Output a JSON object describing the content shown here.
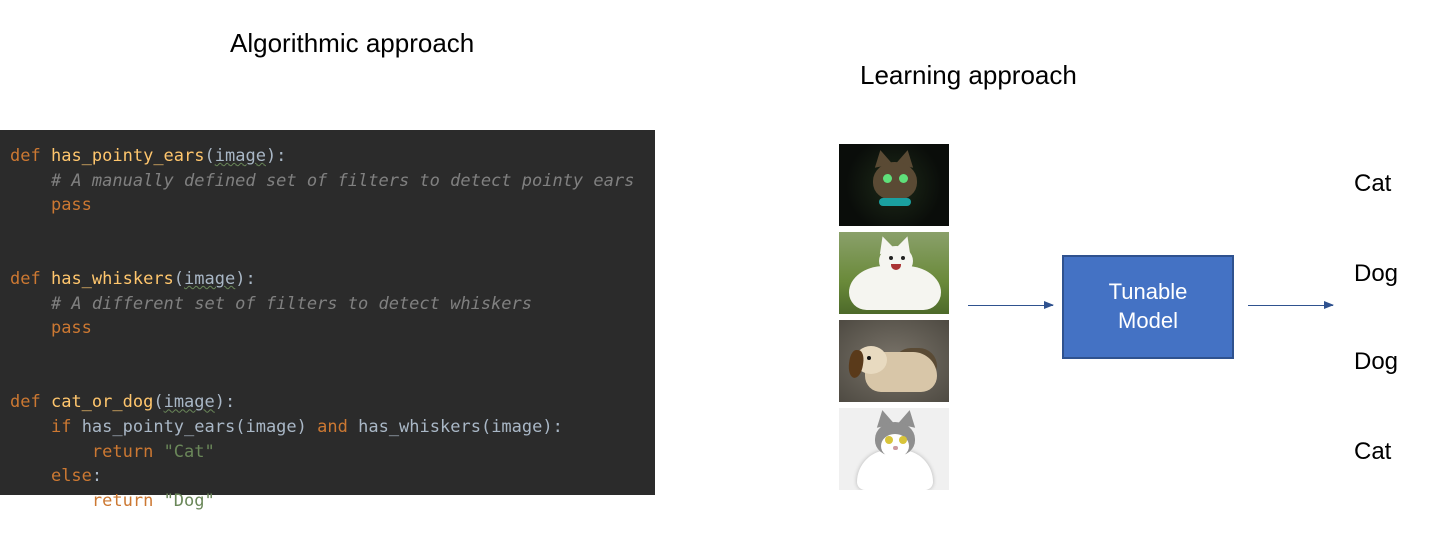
{
  "titles": {
    "left": "Algorithmic approach",
    "right": "Learning approach"
  },
  "code": {
    "fn1": {
      "def": "def",
      "name": "has_pointy_ears",
      "param": "image",
      "comment": "# A manually defined set of filters to detect pointy ears",
      "body": "pass"
    },
    "fn2": {
      "def": "def",
      "name": "has_whiskers",
      "param": "image",
      "comment": "# A different set of filters to detect whiskers",
      "body": "pass"
    },
    "fn3": {
      "def": "def",
      "name": "cat_or_dog",
      "param": "image",
      "if": "if",
      "call1": "has_pointy_ears",
      "arg": "image",
      "and": "and",
      "call2": "has_whiskers",
      "ret": "return",
      "str_cat": "\"Cat\"",
      "else": "else",
      "str_dog": "\"Dog\""
    }
  },
  "model": {
    "line1": "Tunable",
    "line2": "Model"
  },
  "outputs": [
    "Cat",
    "Dog",
    "Dog",
    "Cat"
  ],
  "input_images": [
    {
      "name": "tabby-cat-dark-bg"
    },
    {
      "name": "white-dog-grass"
    },
    {
      "name": "beagle-puppy-gravel"
    },
    {
      "name": "grey-white-cat"
    }
  ]
}
